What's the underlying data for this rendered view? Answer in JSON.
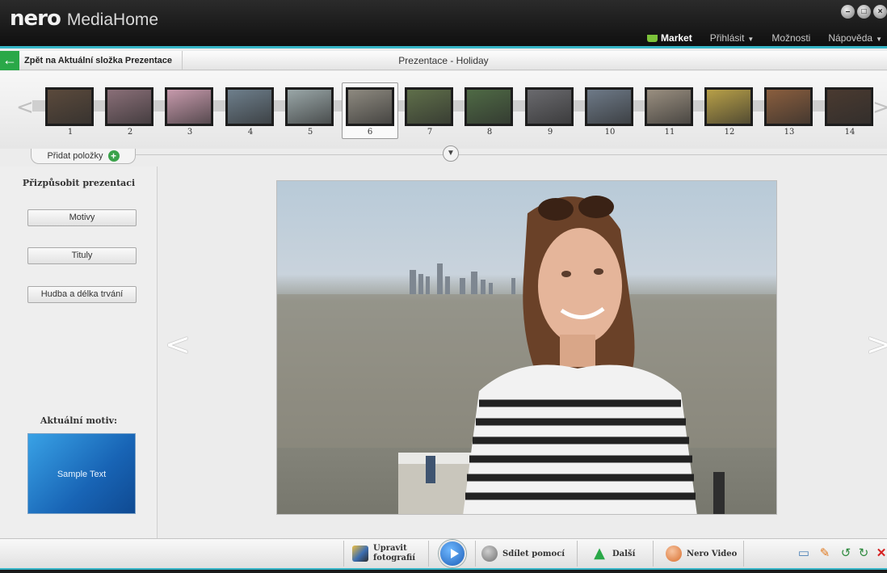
{
  "app": {
    "logo_brand": "nero",
    "logo_product": "MediaHome",
    "window_controls": [
      "minimize-icon",
      "restore-icon",
      "close-icon"
    ]
  },
  "top_menu": {
    "market": "Market",
    "login": "Přihlásit",
    "options": "Možnosti",
    "help": "Nápověda"
  },
  "navbar": {
    "back_label": "Zpět na Aktuální složka Prezentace",
    "title": "Prezentace - Holiday"
  },
  "filmstrip": {
    "selected_index": 6,
    "thumbnails": [
      {
        "num": "1",
        "color": "#5b4a3c"
      },
      {
        "num": "2",
        "color": "#8a6f78"
      },
      {
        "num": "3",
        "color": "#c79aac"
      },
      {
        "num": "4",
        "color": "#6e7f8c"
      },
      {
        "num": "5",
        "color": "#9aa7a8"
      },
      {
        "num": "6",
        "color": "#8e8a80"
      },
      {
        "num": "7",
        "color": "#5f6f4a"
      },
      {
        "num": "8",
        "color": "#4f6a45"
      },
      {
        "num": "9",
        "color": "#6a6a6e"
      },
      {
        "num": "10",
        "color": "#6e7a88"
      },
      {
        "num": "11",
        "color": "#9a8f80"
      },
      {
        "num": "12",
        "color": "#b8a048"
      },
      {
        "num": "13",
        "color": "#8a5e3e"
      },
      {
        "num": "14",
        "color": "#4a3a30"
      }
    ]
  },
  "add_items": {
    "label": "Přidat položky"
  },
  "left_panel": {
    "title": "Přizpůsobit prezentaci",
    "buttons": [
      "Motivy",
      "Tituly",
      "Hudba a délka trvání"
    ],
    "current_motif_label": "Aktuální motiv:",
    "motif_preview_text": "Sample Text"
  },
  "bottom_bar": {
    "edit_photos_line1": "Upravit",
    "edit_photos_line2": "fotografií",
    "share": "Sdílet pomocí",
    "next": "Další",
    "nero_video": "Nero Video"
  },
  "colors": {
    "accent": "#35b5c7",
    "back_green": "#2aa848",
    "market_basket": "#7cc23a"
  }
}
